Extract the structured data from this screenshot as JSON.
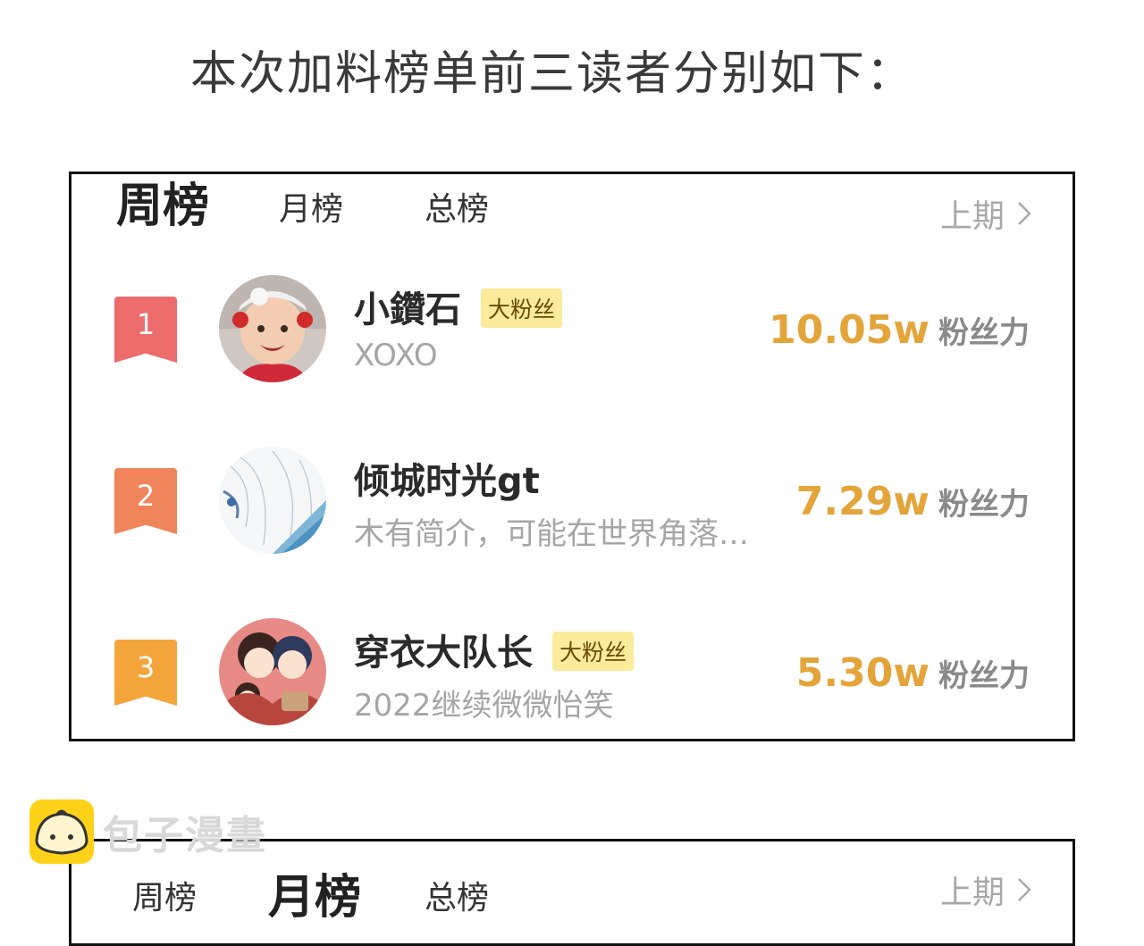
{
  "headline": "本次加料榜单前三读者分别如下：",
  "board1": {
    "tabs": [
      "周榜",
      "月榜",
      "总榜"
    ],
    "active_tab": "周榜",
    "prev_label": "上期",
    "entries": [
      {
        "rank": "1",
        "name": "小鑽石",
        "badge": "大粉丝",
        "bio": "XOXO",
        "score": "10.05w",
        "unit": "粉丝力",
        "rank_color": "#ec6b6b"
      },
      {
        "rank": "2",
        "name": "倾城时光gt",
        "badge": "",
        "bio": "木有简介，可能在世界角落…",
        "score": "7.29w",
        "unit": "粉丝力",
        "rank_color": "#f0845a"
      },
      {
        "rank": "3",
        "name": "穿衣大队长",
        "badge": "大粉丝",
        "bio": "2022继续微微怡笑",
        "score": "5.30w",
        "unit": "粉丝力",
        "rank_color": "#f3a53c"
      }
    ]
  },
  "board2": {
    "tabs": [
      "周榜",
      "月榜",
      "总榜"
    ],
    "active_tab": "月榜",
    "prev_label": "上期"
  },
  "watermark": "包子漫畫",
  "colors": {
    "score": "#e3a43a",
    "badge_bg": "#fbeb9a",
    "border": "#111111"
  }
}
